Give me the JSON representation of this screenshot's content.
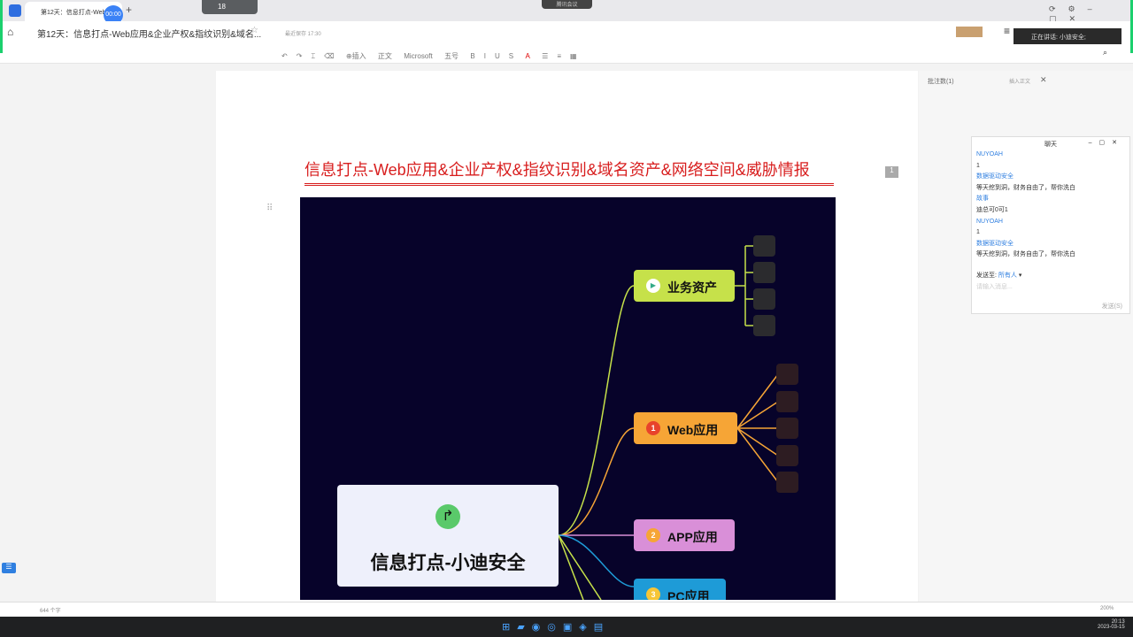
{
  "browser": {
    "tab_title": "第12天：信息打点-Web...",
    "timer": "00:00",
    "meeting_label": "腾讯会议",
    "net_value": "18"
  },
  "header": {
    "doc_title": "第12天：信息打点-Web应用&企业产权&指纹识别&域名...",
    "saved": "最近保存 17:30",
    "speaking": "正在讲话: 小迪安全;"
  },
  "toolbar": {
    "insert": "插入",
    "para": "正文",
    "font": "Microsoft",
    "size": "五号"
  },
  "comments": {
    "count_label": "批注数(1)",
    "insert_label": "插入正文"
  },
  "document": {
    "heading": "信息打点-Web应用&企业产权&指纹识别&域名资产&网络空间&威胁情报",
    "page_badge": "1"
  },
  "mindmap": {
    "root": "信息打点-小迪安全",
    "branches": [
      {
        "label": "业务资产",
        "badge": "▶",
        "color": "#c6e14a"
      },
      {
        "label": "Web应用",
        "badge": "1",
        "color": "#f6a536"
      },
      {
        "label": "APP应用",
        "badge": "2",
        "color": "#d98fd8"
      },
      {
        "label": "PC应用",
        "badge": "3",
        "color": "#1e9bd7"
      }
    ]
  },
  "chat": {
    "title": "聊天",
    "messages": [
      {
        "name": "NUYOAH",
        "text": "1"
      },
      {
        "name": "数据驱动安全",
        "text": "等天挖到洞，财务自由了，帮你洗白"
      },
      {
        "name": "故事",
        "text": "迪总可0可1"
      },
      {
        "name": "NUYOAH",
        "text": "1"
      },
      {
        "name": "数据驱动安全",
        "text": "等天挖到洞，财务自由了，帮你洗白"
      }
    ],
    "send_to_label": "发送至:",
    "send_to_value": "所有人",
    "input_placeholder": "请输入消息...",
    "send_button": "发送(S)"
  },
  "status": {
    "words": "644 个字",
    "zoom": "200%"
  },
  "taskbar": {
    "time": "20:13",
    "date": "2023-03-15"
  }
}
